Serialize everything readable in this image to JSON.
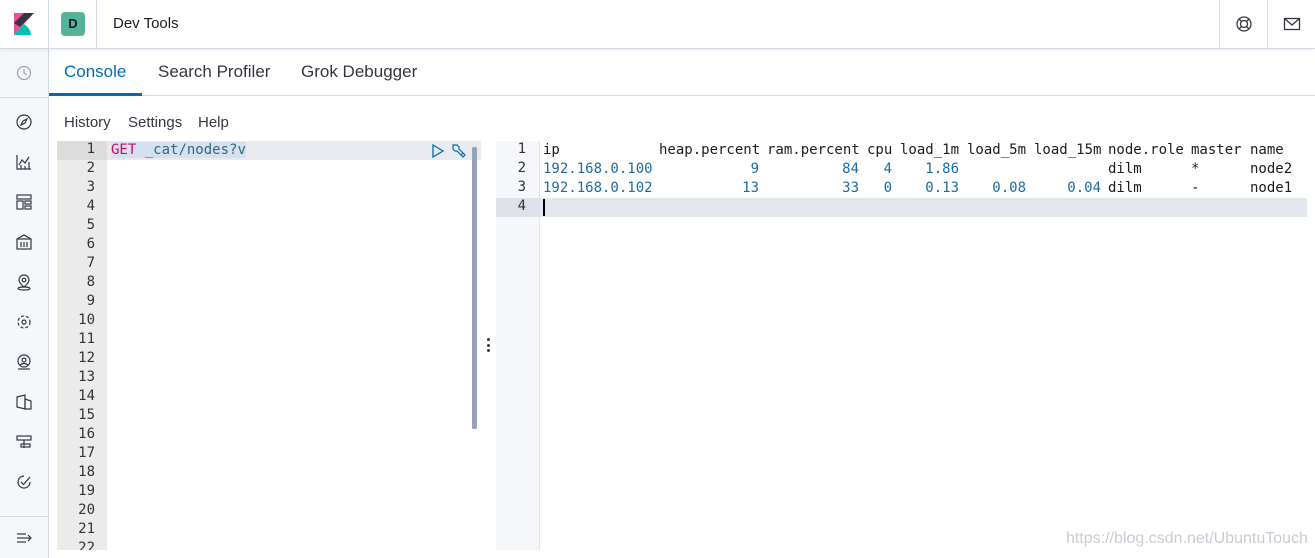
{
  "header": {
    "space_initial": "D",
    "app_title": "Dev Tools",
    "logo_icon": "kibana-logo-icon",
    "help_icon": "help-icon",
    "mail_icon": "mail-icon"
  },
  "colors": {
    "accent": "#006bb4",
    "space_avatar": "#54b399",
    "keyword": "#c80a68",
    "number": "#1f6aa0"
  },
  "leftnav": {
    "icons": [
      "clock-icon",
      "discover-icon",
      "visualize-icon",
      "dashboard-icon",
      "canvas-icon",
      "maps-icon",
      "ml-icon",
      "siem-icon",
      "logs-icon",
      "uptime-icon",
      "apm-icon",
      "collapse-icon"
    ]
  },
  "tabs": [
    {
      "label": "Console"
    },
    {
      "label": "Search Profiler"
    },
    {
      "label": "Grok Debugger"
    }
  ],
  "console_menu": {
    "history": "History",
    "settings": "Settings",
    "help": "Help"
  },
  "editor": {
    "method": "GET",
    "path": "_cat/nodes?v",
    "line_numbers": [
      "1",
      "2",
      "3",
      "4",
      "5",
      "6",
      "7",
      "8",
      "9",
      "10",
      "11",
      "12",
      "13",
      "14",
      "15",
      "16",
      "17",
      "18",
      "19",
      "20",
      "21",
      "22"
    ]
  },
  "output": {
    "line_numbers": [
      "1",
      "2",
      "3",
      "4"
    ],
    "columns": [
      "ip",
      "heap.percent",
      "ram.percent",
      "cpu",
      "load_1m",
      "load_5m",
      "load_15m",
      "node.role",
      "master",
      "name"
    ],
    "rows": [
      [
        "192.168.0.100",
        "9",
        "84",
        "4",
        "1.86",
        "",
        "",
        "dilm",
        "*",
        "node2"
      ],
      [
        "192.168.0.102",
        "13",
        "33",
        "0",
        "0.13",
        "0.08",
        "0.04",
        "dilm",
        "-",
        "node1"
      ]
    ]
  },
  "watermark": "https://blog.csdn.net/UbuntuTouch"
}
